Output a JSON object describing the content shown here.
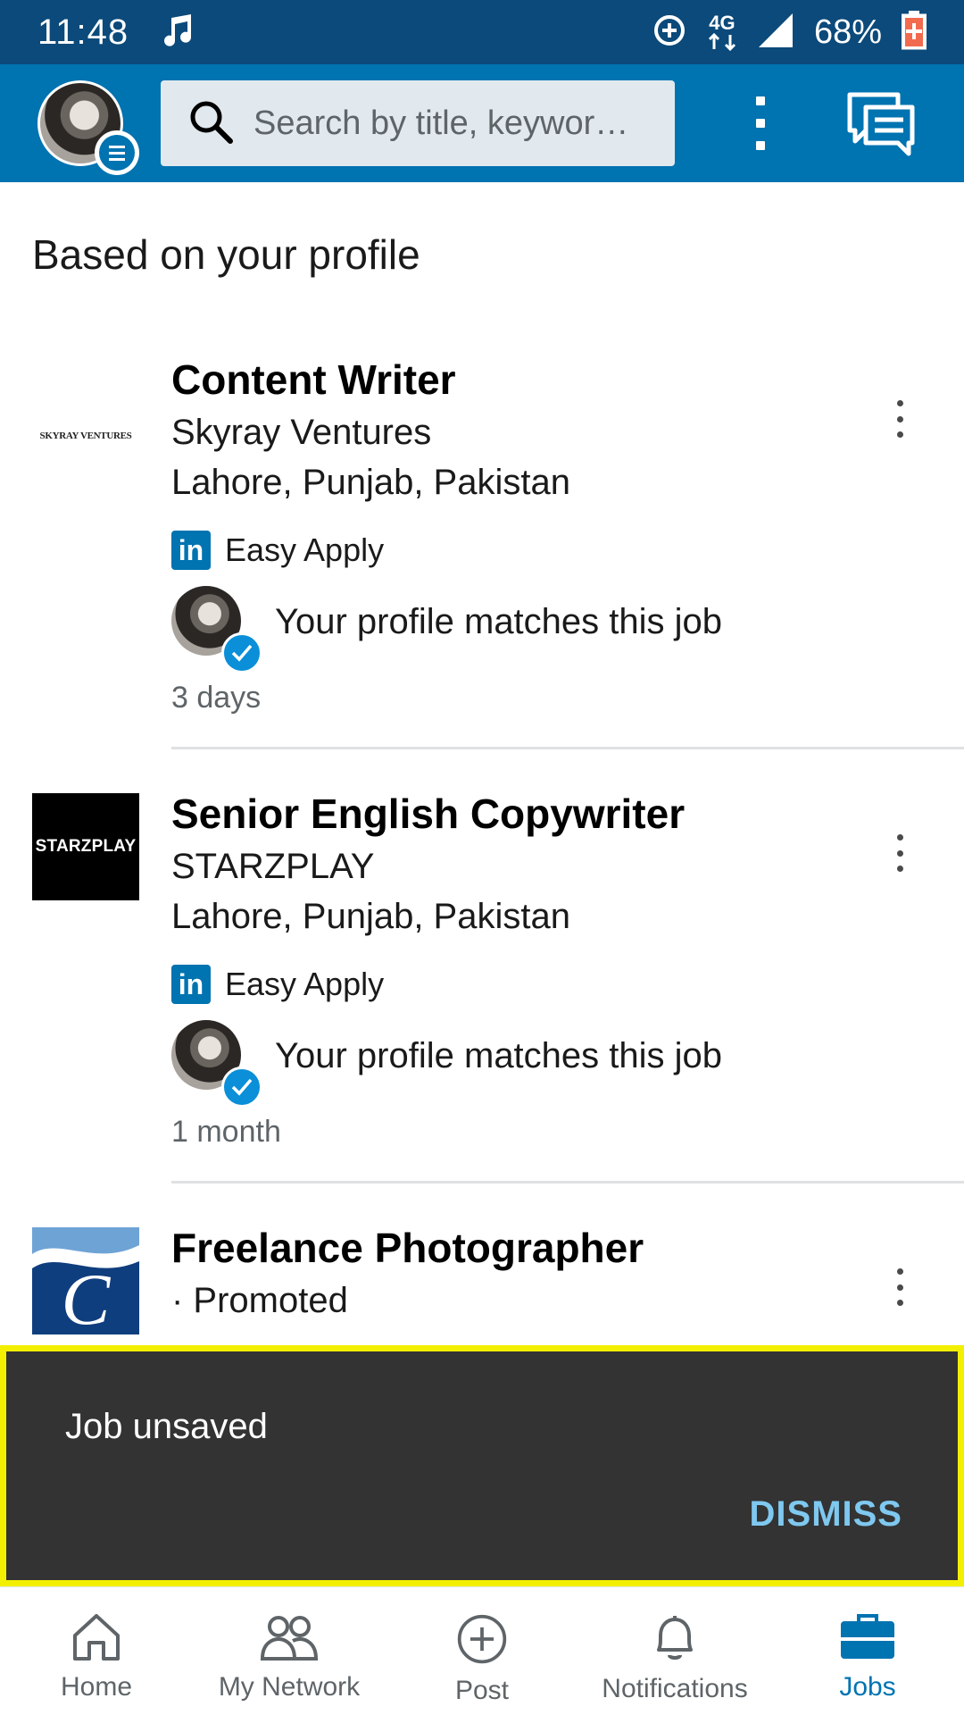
{
  "status_bar": {
    "time": "11:48",
    "network": "4G",
    "battery": "68%"
  },
  "app_bar": {
    "search_placeholder": "Search by title, keywor…"
  },
  "section_title": "Based on your profile",
  "jobs": [
    {
      "title": "Content Writer",
      "company": "Skyray Ventures",
      "location": "Lahore, Punjab, Pakistan",
      "easy_apply": "Easy Apply",
      "match": "Your profile matches this job",
      "age": "3 days",
      "logo_text": "SKYRAY VENTURES"
    },
    {
      "title": "Senior English Copywriter",
      "company": "STARZPLAY",
      "location": "Lahore, Punjab, Pakistan",
      "easy_apply": "Easy Apply",
      "match": "Your profile matches this job",
      "age": "1 month",
      "logo_text": "STARZPLAY"
    },
    {
      "title": "Freelance Photographer",
      "company": "· Promoted"
    }
  ],
  "snackbar": {
    "message": "Job unsaved",
    "action": "DISMISS"
  },
  "bottom_nav": {
    "home": "Home",
    "network": "My Network",
    "post": "Post",
    "notifications": "Notifications",
    "jobs": "Jobs"
  },
  "colors": {
    "brand": "#0073b1",
    "status_bar": "#0b4a7a",
    "snackbar": "#333333",
    "snackbar_highlight": "#f3ef00",
    "dismiss": "#7fc8f0"
  },
  "icons": [
    "music-icon",
    "sync-icon",
    "signal-icon",
    "battery-icon",
    "search-icon",
    "overflow-menu-icon",
    "messaging-icon",
    "linkedin-icon",
    "checkmark-icon",
    "home-icon",
    "my-network-icon",
    "post-icon",
    "notifications-icon",
    "jobs-icon"
  ]
}
